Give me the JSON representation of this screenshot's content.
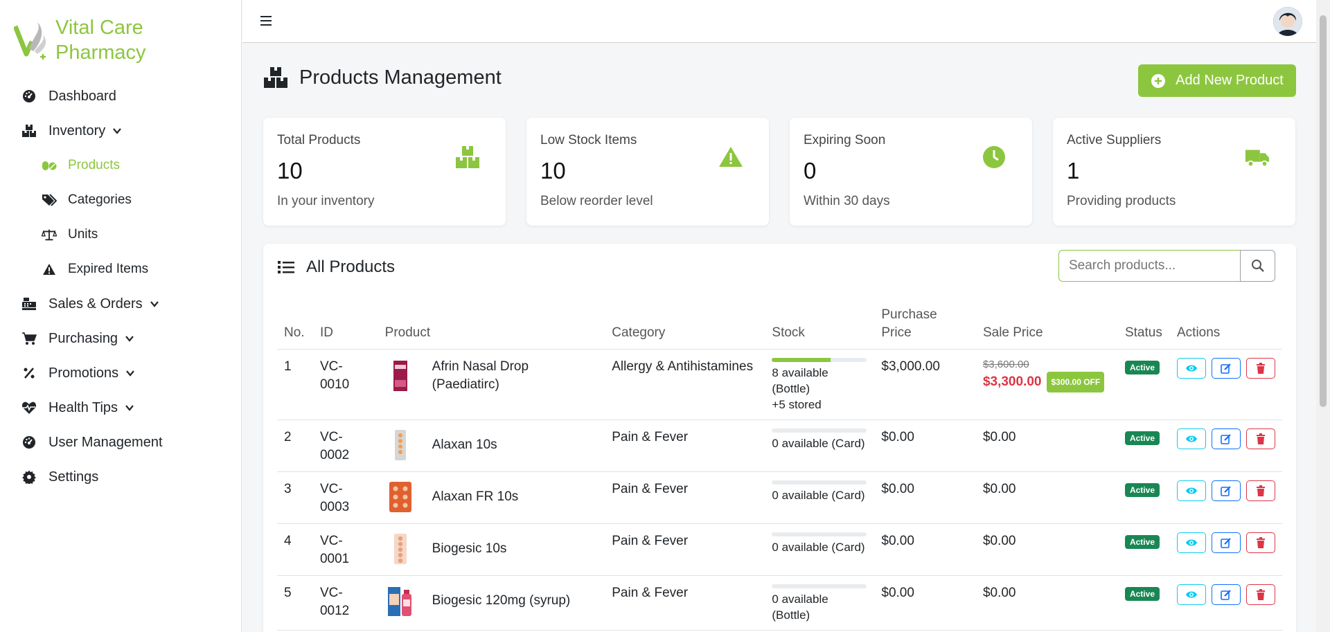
{
  "brand": {
    "line1": "Vital Care",
    "line2": "Pharmacy"
  },
  "colors": {
    "accent": "#8cc63f",
    "danger": "#dc3545",
    "success": "#198754",
    "info": "#0dcaf0",
    "primary": "#0d6efd"
  },
  "sidebar": {
    "items": [
      {
        "label": "Dashboard",
        "icon": "dashboard-gauge-icon"
      },
      {
        "label": "Inventory",
        "icon": "boxes-icon",
        "expanded": true
      },
      {
        "label": "Sales & Orders",
        "icon": "cash-register-icon"
      },
      {
        "label": "Purchasing",
        "icon": "cart-icon"
      },
      {
        "label": "Promotions",
        "icon": "percent-icon"
      },
      {
        "label": "Health Tips",
        "icon": "heart-pulse-icon"
      },
      {
        "label": "User Management",
        "icon": "gauge-icon"
      },
      {
        "label": "Settings",
        "icon": "gear-icon"
      }
    ],
    "inventory_sub": [
      {
        "label": "Products",
        "icon": "pills-icon",
        "active": true
      },
      {
        "label": "Categories",
        "icon": "tags-icon"
      },
      {
        "label": "Units",
        "icon": "scale-icon"
      },
      {
        "label": "Expired Items",
        "icon": "warning-icon"
      }
    ]
  },
  "page": {
    "title": "Products Management",
    "add_button": "Add New Product"
  },
  "stats": [
    {
      "label": "Total Products",
      "value": "10",
      "sub": "In your inventory",
      "icon": "boxes-icon"
    },
    {
      "label": "Low Stock Items",
      "value": "10",
      "sub": "Below reorder level",
      "icon": "warning-icon"
    },
    {
      "label": "Expiring Soon",
      "value": "0",
      "sub": "Within 30 days",
      "icon": "clock-icon"
    },
    {
      "label": "Active Suppliers",
      "value": "1",
      "sub": "Providing products",
      "icon": "truck-icon"
    }
  ],
  "products_card": {
    "title": "All Products",
    "search_placeholder": "Search products...",
    "columns": [
      "No.",
      "ID",
      "Product",
      "Category",
      "Stock",
      "Purchase Price",
      "Sale Price",
      "Status",
      "Actions"
    ],
    "rows": [
      {
        "no": "1",
        "id": "VC-0010",
        "product": "Afrin Nasal Drop (Paediatirc)",
        "category": "Allergy & Antihistamines",
        "stock_fraction": 0.62,
        "stock_line1": "8 available",
        "stock_line2": "(Bottle)",
        "stock_line3": "+5 stored",
        "purchase": "$3,000.00",
        "sale_old": "$3,600.00",
        "sale": "$3,300.00",
        "discount": "$300.00 OFF",
        "status": "Active"
      },
      {
        "no": "2",
        "id": "VC-0002",
        "product": "Alaxan 10s",
        "category": "Pain & Fever",
        "stock_fraction": 0,
        "stock_line1": "0 available (Card)",
        "stock_line2": "",
        "stock_line3": "",
        "purchase": "$0.00",
        "sale_old": "",
        "sale": "$0.00",
        "discount": "",
        "status": "Active"
      },
      {
        "no": "3",
        "id": "VC-0003",
        "product": "Alaxan FR 10s",
        "category": "Pain & Fever",
        "stock_fraction": 0,
        "stock_line1": "0 available (Card)",
        "stock_line2": "",
        "stock_line3": "",
        "purchase": "$0.00",
        "sale_old": "",
        "sale": "$0.00",
        "discount": "",
        "status": "Active"
      },
      {
        "no": "4",
        "id": "VC-0001",
        "product": "Biogesic 10s",
        "category": "Pain & Fever",
        "stock_fraction": 0,
        "stock_line1": "0 available (Card)",
        "stock_line2": "",
        "stock_line3": "",
        "purchase": "$0.00",
        "sale_old": "",
        "sale": "$0.00",
        "discount": "",
        "status": "Active"
      },
      {
        "no": "5",
        "id": "VC-0012",
        "product": "Biogesic 120mg (syrup)",
        "category": "Pain & Fever",
        "stock_fraction": 0,
        "stock_line1": "0 available",
        "stock_line2": "(Bottle)",
        "stock_line3": "",
        "purchase": "$0.00",
        "sale_old": "",
        "sale": "$0.00",
        "discount": "",
        "status": "Active"
      }
    ]
  }
}
